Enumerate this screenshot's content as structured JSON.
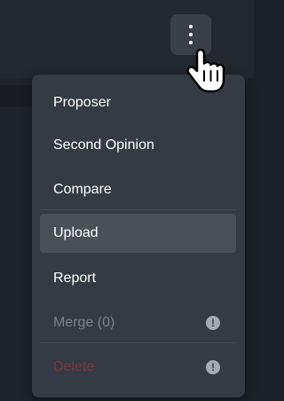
{
  "toolbar": {
    "more_icon": "vertical-ellipsis-icon"
  },
  "menu": {
    "items": [
      {
        "label": "Proposer",
        "state": "normal"
      },
      {
        "label": "Second Opinion",
        "state": "normal"
      },
      {
        "label": "Compare",
        "state": "normal"
      },
      {
        "label": "Upload",
        "state": "hover"
      },
      {
        "label": "Report",
        "state": "normal"
      },
      {
        "label": "Merge (0)",
        "state": "disabled",
        "icon": "warning-icon"
      },
      {
        "label": "Delete",
        "state": "disabled-danger",
        "icon": "warning-icon"
      }
    ],
    "warning_glyph": "!"
  },
  "colors": {
    "menu_bg": "#343b44",
    "hover_bg": "#48505a",
    "text": "#ffffff",
    "disabled_text": "#7a828c",
    "danger_text": "#83323a"
  },
  "cursor_icon": "hand-pointer-icon"
}
